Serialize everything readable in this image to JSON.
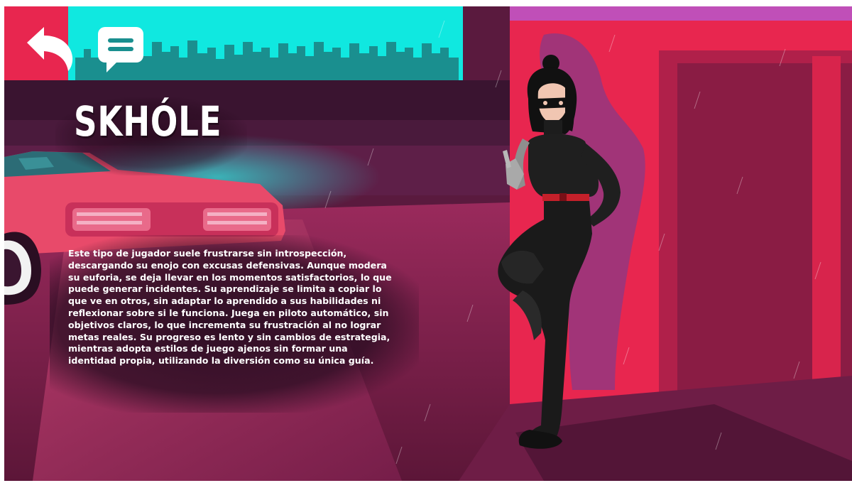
{
  "screen": {
    "title": "SKHÓLE",
    "description": "Este tipo de jugador suele frustrarse sin introspección, descargando su enojo con excusas defensivas. Aunque modera su euforia, se deja llevar en los momentos satisfactorios, lo que puede generar incidentes. Su aprendizaje se limita a copiar lo que ve en otros, sin adaptar lo aprendido a sus habilidades ni reflexionar sobre si le funciona. Juega en piloto automático, sin objetivos claros, lo que incrementa su frustración al no lograr metas reales. Su progreso es lento y sin cambios de estrategia, mientras adopta estilos de juego ajenos sin formar una identidad propia, utilizando la diversión como su única guía."
  },
  "toolbar": {
    "back_icon": "back-arrow-icon",
    "chat_icon": "chat-bubble-icon"
  },
  "colors": {
    "sky_cyan": "#10e8e0",
    "skyline_teal": "#1a8f8f",
    "wall_pink": "#e8264f",
    "roof_purple": "#c04fb8",
    "street_magenta": "#8a2457",
    "text_white": "#ffffff"
  }
}
